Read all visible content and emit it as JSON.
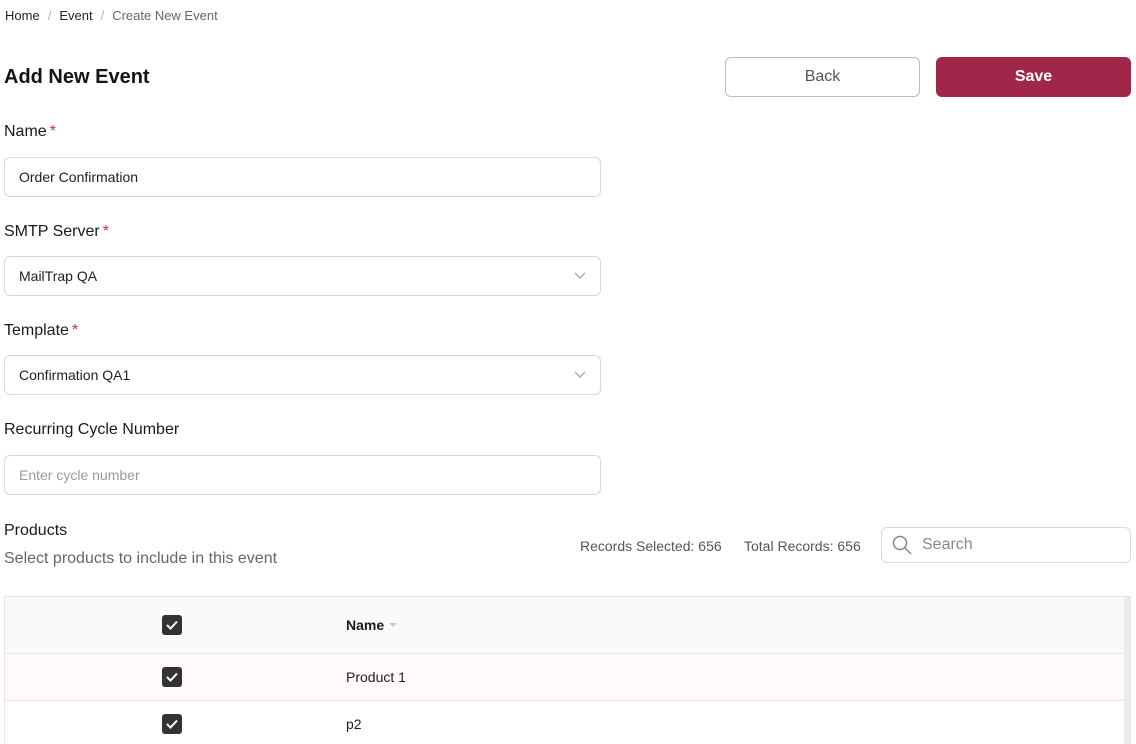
{
  "breadcrumb": {
    "home": "Home",
    "event": "Event",
    "current": "Create New Event"
  },
  "header": {
    "title": "Add New Event",
    "back_label": "Back",
    "save_label": "Save"
  },
  "form": {
    "name": {
      "label": "Name",
      "value": "Order Confirmation"
    },
    "smtp": {
      "label": "SMTP Server",
      "value": "MailTrap QA"
    },
    "template": {
      "label": "Template",
      "value": "Confirmation QA1"
    },
    "cycle": {
      "label": "Recurring Cycle Number",
      "placeholder": "Enter cycle number",
      "value": ""
    },
    "required_mark": "*"
  },
  "products": {
    "title": "Products",
    "subtitle": "Select products to include in this event",
    "records_selected": "Records Selected: 656",
    "total_records": "Total Records: 656",
    "search_placeholder": "Search"
  },
  "table": {
    "columns": [
      {
        "label": "Name"
      }
    ],
    "rows": [
      {
        "name": "Product 1",
        "checked": true
      },
      {
        "name": "p2",
        "checked": true
      }
    ]
  },
  "colors": {
    "accent": "#a0264a",
    "required": "#d32f2f"
  },
  "icons": {
    "dropdown": "chevron-down-icon",
    "search": "search-icon",
    "check": "checkmark-icon",
    "sort": "sort-down-icon"
  }
}
